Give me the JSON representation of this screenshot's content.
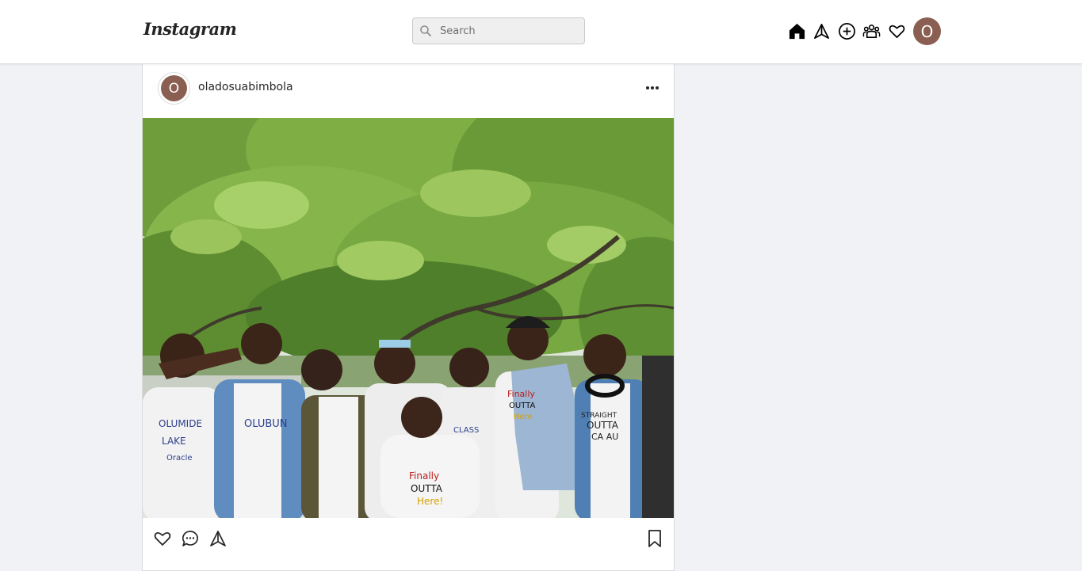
{
  "header": {
    "logo_text": "Instagram",
    "search": {
      "placeholder": "Search",
      "value": ""
    },
    "nav_icons": [
      "home-icon",
      "direct-messages-icon",
      "new-post-icon",
      "explore-people-icon",
      "activity-heart-icon"
    ],
    "profile_initial": "O"
  },
  "post": {
    "username": "oladosuabimbola",
    "avatar_initial": "O",
    "image": {
      "shirt_texts": [
        "OLUBUN",
        "CLASS",
        "Finally",
        "OUTTA",
        "Here!",
        "STRAIGHT",
        "OUTTA",
        "CA AU",
        "Finally",
        "OUTTA",
        "Here",
        "OLUMIDE",
        "LAKE",
        "Oracle"
      ]
    },
    "action_icons": [
      "like-heart-icon",
      "comment-icon",
      "share-icon",
      "save-bookmark-icon"
    ]
  },
  "colors": {
    "page_background": "#f0f2f5",
    "avatar_brown": "#8a5f52",
    "border": "#dbdbdb"
  }
}
